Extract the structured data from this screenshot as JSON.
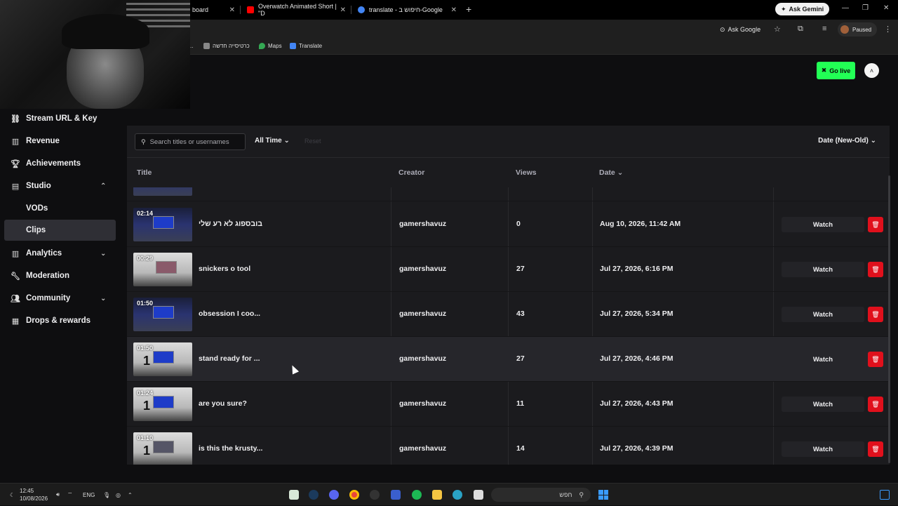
{
  "browser": {
    "tabs": [
      {
        "label": "board",
        "favicon_color": "#9146ff"
      },
      {
        "label": "Overwatch Animated Short | \"D",
        "favicon_color": "#ff0000"
      },
      {
        "label": "translate - חיפוש ב-Google",
        "favicon_color": "#4285f4"
      }
    ],
    "new_tab_icon": "plus-icon",
    "gemini_label": "Ask Gemini",
    "ask_google_label": "Ask Google",
    "profile_status": "Paused",
    "bookmarks": [
      {
        "label": "כרטיסייה חדשה",
        "color": "#888888"
      },
      {
        "label": "Maps",
        "color": "#34a853"
      },
      {
        "label": "Translate",
        "color": "#4285f4"
      }
    ]
  },
  "header": {
    "go_live_label": "Go live",
    "accent": "#22ff55"
  },
  "sidebar": {
    "items": [
      {
        "label": "Stream URL & Key",
        "icon": "link-icon"
      },
      {
        "label": "Revenue",
        "icon": "chart-icon"
      },
      {
        "label": "Achievements",
        "icon": "trophy-icon"
      },
      {
        "label": "Studio",
        "icon": "film-icon",
        "expanded": true
      },
      {
        "label": "VODs",
        "sub": true
      },
      {
        "label": "Clips",
        "sub": true,
        "active": true
      },
      {
        "label": "Analytics",
        "icon": "chart-icon",
        "expanded": false
      },
      {
        "label": "Moderation",
        "icon": "wrench-icon"
      },
      {
        "label": "Community",
        "icon": "people-icon",
        "expanded": false
      },
      {
        "label": "Drops & rewards",
        "icon": "gift-icon"
      }
    ]
  },
  "filters": {
    "search_placeholder": "Search titles or usernames",
    "time_range": "All Time",
    "reset_label": "Reset",
    "sort": "Date (New-Old)"
  },
  "table": {
    "headers": {
      "title": "Title",
      "creator": "Creator",
      "views": "Views",
      "date": "Date"
    },
    "watch_label": "Watch",
    "delete_color": "#e0101c",
    "rows": [
      {
        "duration": "02:14",
        "title": "בובספוג לא רע שלי",
        "creator": "gamershavuz",
        "views": "0",
        "date": "Aug 10, 2026, 11:42 AM"
      },
      {
        "duration": "00:29",
        "title": "snickers o tool",
        "creator": "gamershavuz",
        "views": "27",
        "date": "Jul 27, 2026, 6:16 PM"
      },
      {
        "duration": "01:50",
        "title": "obsession I coo...",
        "creator": "gamershavuz",
        "views": "43",
        "date": "Jul 27, 2026, 5:34 PM"
      },
      {
        "duration": "01:50",
        "title": "stand ready for ...",
        "creator": "gamershavuz",
        "views": "27",
        "date": "Jul 27, 2026, 4:46 PM"
      },
      {
        "duration": "01:24",
        "title": "are you sure?",
        "creator": "gamershavuz",
        "views": "11",
        "date": "Jul 27, 2026, 4:43 PM"
      },
      {
        "duration": "01:10",
        "title": "is this the krusty...",
        "creator": "gamershavuz",
        "views": "14",
        "date": "Jul 27, 2026, 4:39 PM"
      }
    ]
  },
  "taskbar": {
    "time": "12:45",
    "date": "10/08/2026",
    "lang": "ENG",
    "search_placeholder": "חפש"
  }
}
